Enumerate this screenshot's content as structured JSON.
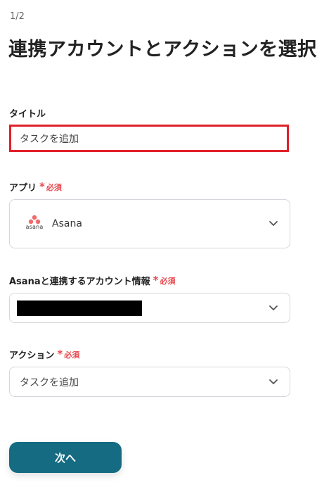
{
  "step": "1/2",
  "page_title": "連携アカウントとアクションを選択",
  "required_label": "必須",
  "title_field": {
    "label": "タイトル",
    "value": "タスクを追加",
    "highlight_color": "#e0202a"
  },
  "app_field": {
    "label": "アプリ",
    "selected_app": "Asana",
    "logo_text": "asana",
    "logo_icon": "asana-logo-icon",
    "logo_color": "#f06a6a"
  },
  "account_field": {
    "label": "Asanaと連携するアカウント情報",
    "value_redacted": true
  },
  "action_field": {
    "label": "アクション",
    "value": "タスクを追加"
  },
  "next_button": {
    "label": "次へ",
    "color": "#146b82"
  },
  "colors": {
    "required": "#e5484d",
    "border": "#d4d7dc",
    "text": "#222222"
  }
}
